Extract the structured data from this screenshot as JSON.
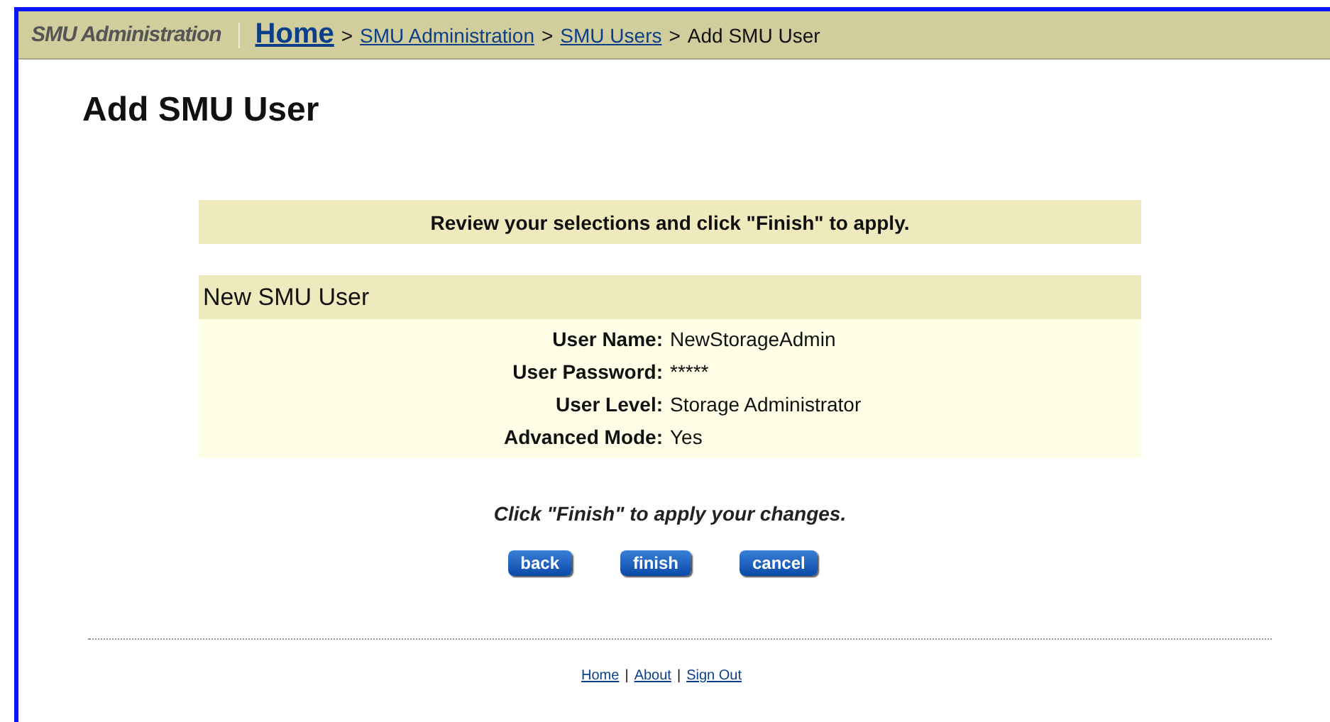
{
  "header": {
    "app_title": "SMU Administration",
    "breadcrumb": [
      {
        "label": "Home",
        "kind": "home"
      },
      {
        "label": "SMU Administration",
        "kind": "link"
      },
      {
        "label": "SMU Users",
        "kind": "link"
      },
      {
        "label": "Add SMU User",
        "kind": "current"
      }
    ],
    "separator": ">"
  },
  "page_title": "Add SMU User",
  "review_banner": "Review your selections and click \"Finish\" to apply.",
  "summary": {
    "title": "New SMU User",
    "fields": [
      {
        "label": "User Name:",
        "value": "NewStorageAdmin"
      },
      {
        "label": "User Password:",
        "value": "*****"
      },
      {
        "label": "User Level:",
        "value": "Storage Administrator"
      },
      {
        "label": "Advanced Mode:",
        "value": "Yes"
      }
    ]
  },
  "instruction": "Click \"Finish\" to apply your changes.",
  "buttons": [
    "back",
    "finish",
    "cancel"
  ],
  "footer": {
    "links": [
      "Home",
      "About",
      "Sign Out"
    ],
    "separator": "|"
  }
}
